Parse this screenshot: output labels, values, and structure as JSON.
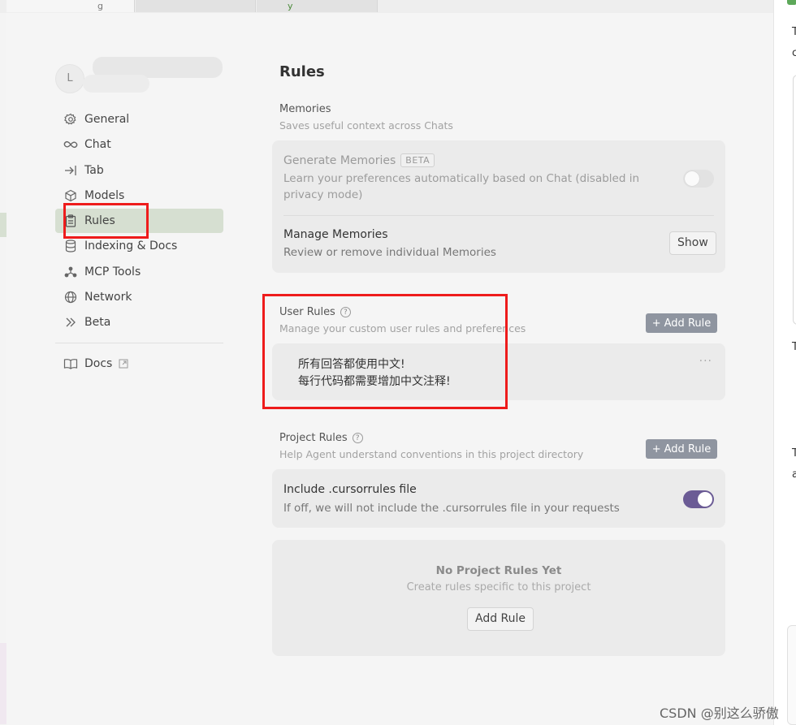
{
  "top_tabs": [
    "g",
    "",
    "y"
  ],
  "profile": {
    "initial": "L"
  },
  "sidebar": {
    "items": [
      {
        "label": "General",
        "icon": "gear-icon"
      },
      {
        "label": "Chat",
        "icon": "infinity-icon"
      },
      {
        "label": "Tab",
        "icon": "arrow-to-line-icon"
      },
      {
        "label": "Models",
        "icon": "cube-icon"
      },
      {
        "label": "Rules",
        "icon": "clipboard-icon",
        "active": true
      },
      {
        "label": "Indexing & Docs",
        "icon": "database-icon"
      },
      {
        "label": "MCP Tools",
        "icon": "nodes-icon"
      },
      {
        "label": "Network",
        "icon": "globe-icon"
      },
      {
        "label": "Beta",
        "icon": "double-chevron-icon"
      }
    ],
    "docs": {
      "label": "Docs",
      "icon": "book-icon"
    }
  },
  "page": {
    "title": "Rules"
  },
  "memories": {
    "label": "Memories",
    "desc": "Saves useful context across Chats",
    "generate": {
      "title": "Generate Memories",
      "badge": "BETA",
      "desc": "Learn your preferences automatically based on Chat (disabled in privacy mode)",
      "enabled": false
    },
    "manage": {
      "title": "Manage Memories",
      "desc": "Review or remove individual Memories",
      "button": "Show"
    }
  },
  "user_rules": {
    "label": "User Rules",
    "desc": "Manage your custom user rules and preferences",
    "add_button": "Add Rule",
    "rule_text": "所有回答都使用中文!\n每行代码都需要增加中文注释!",
    "menu": "···"
  },
  "project_rules": {
    "label": "Project Rules",
    "desc": "Help Agent understand conventions in this project directory",
    "add_button": "Add Rule",
    "include": {
      "title": "Include .cursorrules file",
      "desc": "If off, we will not include the .cursorrules file in your requests",
      "enabled": true
    },
    "empty": {
      "title": "No Project Rules Yet",
      "desc": "Create rules specific to this project",
      "button": "Add Rule"
    }
  },
  "right_edge_letters": [
    "T",
    "c",
    "T",
    "T",
    "a"
  ],
  "watermark": "CSDN @别这么骄傲",
  "colors": {
    "accent": "#6b5b95",
    "active_nav": "#d6dfd1",
    "highlight": "#ee1c1c"
  }
}
